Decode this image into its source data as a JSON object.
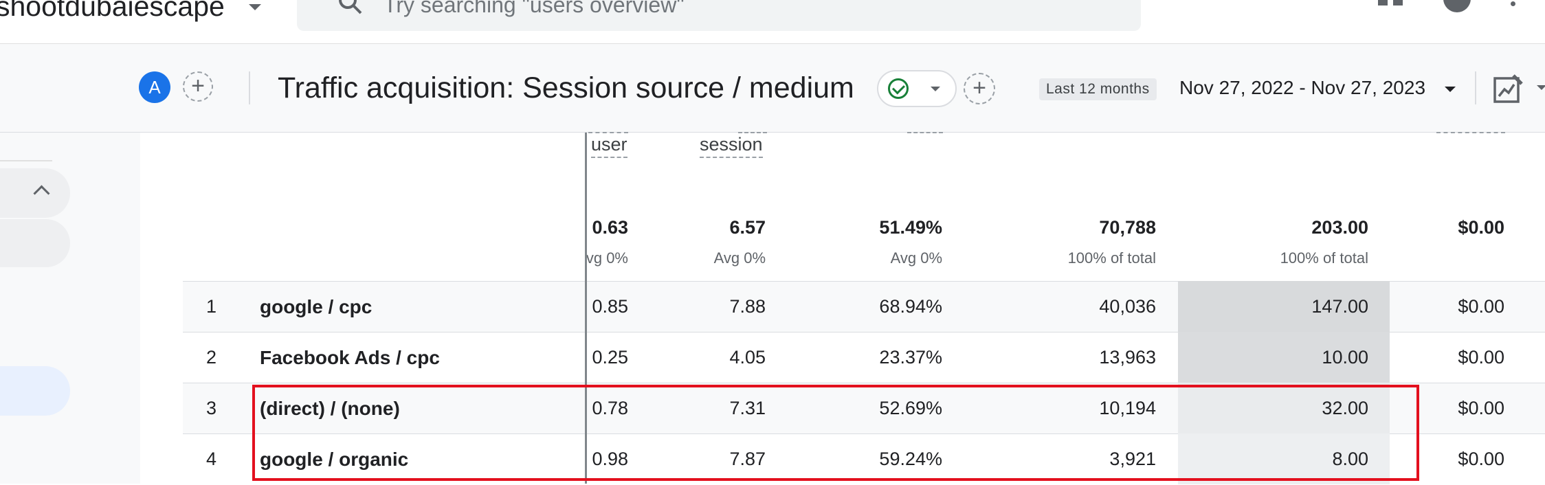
{
  "topbar": {
    "account_name": "shootdubaiescape",
    "search_placeholder": "Try searching \"users overview\""
  },
  "header": {
    "comparison_avatar": "A",
    "report_title": "Traffic acquisition: Session source / medium",
    "date_chip": "Last 12 months",
    "date_range": "Nov 27, 2022 - Nov 27, 2023"
  },
  "table": {
    "metric_headers": [
      "user",
      "session"
    ],
    "totals": {
      "values": [
        "0.63",
        "6.57",
        "51.49%",
        "70,788",
        "203.00",
        "$0.00"
      ],
      "subtexts": [
        "vg 0%",
        "Avg 0%",
        "Avg 0%",
        "100% of total",
        "100% of total"
      ]
    },
    "rows": [
      {
        "rank": "1",
        "dimension": "google / cpc",
        "cells": [
          "0.85",
          "7.88",
          "68.94%",
          "40,036",
          "147.00",
          "$0.00"
        ],
        "heat": 0.72
      },
      {
        "rank": "2",
        "dimension": "Facebook Ads / cpc",
        "cells": [
          "0.25",
          "4.05",
          "23.37%",
          "13,963",
          "10.00",
          "$0.00"
        ],
        "heat": 0.05
      },
      {
        "rank": "3",
        "dimension": "(direct) / (none)",
        "cells": [
          "0.78",
          "7.31",
          "52.69%",
          "10,194",
          "32.00",
          "$0.00"
        ],
        "heat": 0.16
      },
      {
        "rank": "4",
        "dimension": "google / organic",
        "cells": [
          "0.98",
          "7.87",
          "59.24%",
          "3,921",
          "8.00",
          "$0.00"
        ],
        "heat": 0.04
      }
    ]
  },
  "colors": {
    "accent": "#1a73e8",
    "highlight_box": "#e3101e",
    "check_green": "#188038"
  }
}
